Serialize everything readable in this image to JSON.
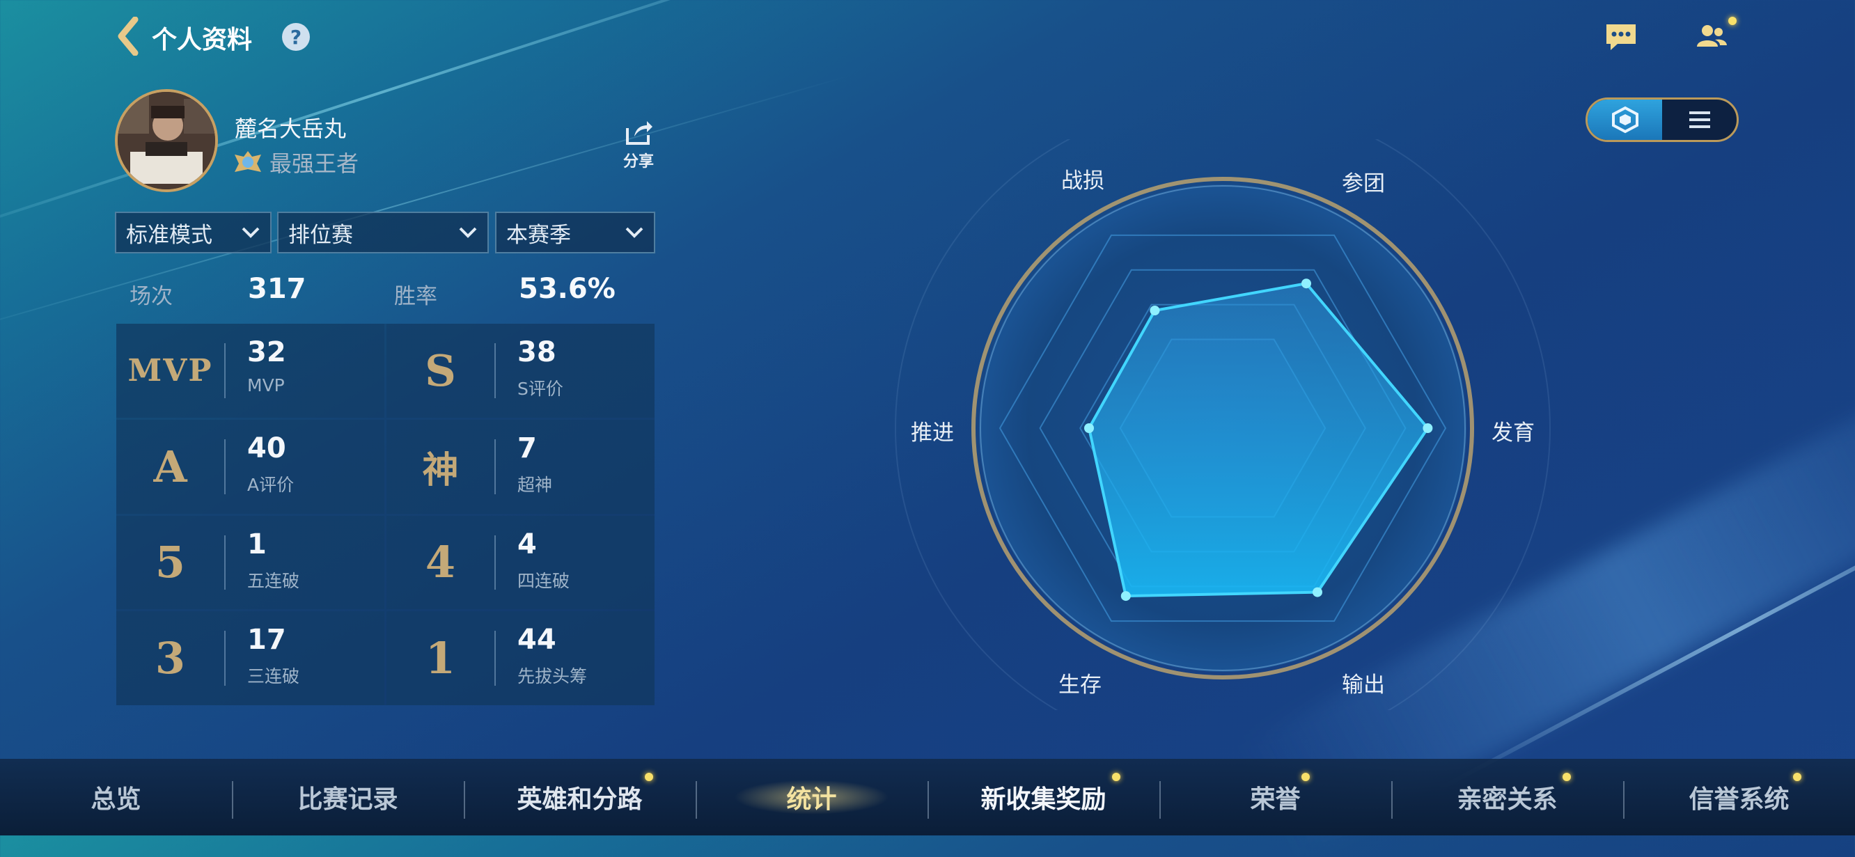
{
  "header": {
    "title": "个人资料",
    "help_icon": "?",
    "back_icon": "chevron-left-icon",
    "chat_icon": "chat-icon",
    "friends_icon": "friends-icon"
  },
  "profile": {
    "nickname": "麓名大岳丸",
    "rank": "最强王者",
    "share_label": "分享"
  },
  "filters": {
    "mode": "标准模式",
    "match_type": "排位赛",
    "season": "本赛季"
  },
  "summary": {
    "games_label": "场次",
    "games_value": "317",
    "winrate_label": "胜率",
    "winrate_value": "53.6%"
  },
  "stats": [
    {
      "icon": "MVP",
      "value": "32",
      "label": "MVP"
    },
    {
      "icon": "S",
      "value": "38",
      "label": "S评价"
    },
    {
      "icon": "A",
      "value": "40",
      "label": "A评价"
    },
    {
      "icon": "神",
      "value": "7",
      "label": "超神"
    },
    {
      "icon": "5",
      "value": "1",
      "label": "五连破"
    },
    {
      "icon": "4",
      "value": "4",
      "label": "四连破"
    },
    {
      "icon": "3",
      "value": "17",
      "label": "三连破"
    },
    {
      "icon": "1",
      "value": "44",
      "label": "先拔头筹"
    }
  ],
  "radar": {
    "labels": {
      "top_left": "战损",
      "top_right": "参团",
      "right": "发育",
      "bottom_right": "输出",
      "bottom_left": "生存",
      "left": "推进"
    },
    "levels": {
      "战损": 0.61,
      "参团": 0.75,
      "发育": 0.92,
      "输出": 0.85,
      "生存": 0.87,
      "推进": 0.6
    }
  },
  "view_toggle": {
    "options": [
      "radar-icon",
      "list-icon"
    ],
    "active": 0
  },
  "nav": {
    "tabs": [
      "总览",
      "比赛记录",
      "英雄和分路",
      "统计",
      "新收集奖励",
      "荣誉",
      "亲密关系",
      "信誉系统"
    ],
    "active": 3,
    "highlight_color": "#f3e2a0"
  },
  "colors": {
    "accent_gold": "#c4a978",
    "radar_fill": "#1aa6e8",
    "notification_dot": "#f8e06a"
  }
}
